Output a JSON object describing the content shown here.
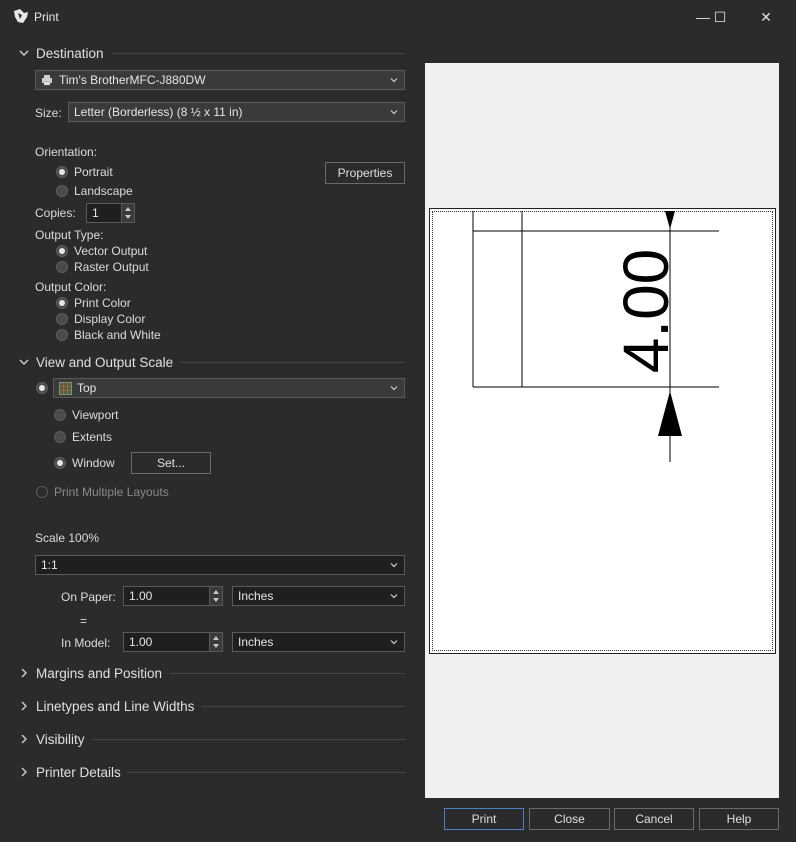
{
  "window": {
    "title": "Print",
    "minimize_glyph": "—",
    "maximize_glyph": "☐",
    "close_glyph": "✕"
  },
  "destination": {
    "header": "Destination",
    "printer": "Tim's BrotherMFC-J880DW",
    "size_label": "Size:",
    "size_value": "Letter (Borderless) (8 ½ x 11 in)",
    "orientation_label": "Orientation:",
    "portrait_label": "Portrait",
    "landscape_label": "Landscape",
    "orientation_selected": "Portrait",
    "properties_button": "Properties",
    "copies_label": "Copies:",
    "copies_value": "1",
    "output_type_label": "Output Type:",
    "vector_output_label": "Vector Output",
    "raster_output_label": "Raster Output",
    "output_type_selected": "Vector Output",
    "output_color_label": "Output Color:",
    "print_color_label": "Print Color",
    "display_color_label": "Display Color",
    "black_white_label": "Black and White",
    "output_color_selected": "Print Color"
  },
  "view_scale": {
    "header": "View and Output Scale",
    "view_value": "Top",
    "viewport_label": "Viewport",
    "extents_label": "Extents",
    "window_label": "Window",
    "area_selected": "Window",
    "set_button": "Set...",
    "print_multiple_label": "Print Multiple Layouts",
    "scale_label": "Scale 100%",
    "scale_value": "1:1",
    "on_paper_label": "On Paper:",
    "on_paper_value": "1.00",
    "on_paper_units": "Inches",
    "equals": "=",
    "in_model_label": "In Model:",
    "in_model_value": "1.00",
    "in_model_units": "Inches"
  },
  "collapsed_sections": {
    "margins": "Margins and Position",
    "linetypes": "Linetypes and Line Widths",
    "visibility": "Visibility",
    "printer_details": "Printer Details"
  },
  "preview": {
    "dimension_text": "4.00"
  },
  "footer": {
    "print_button": "Print",
    "close_button": "Close",
    "cancel_button": "Cancel",
    "help_button": "Help"
  },
  "colors": {
    "background": "#2b2b2b",
    "field": "#1f1f1f",
    "accent_border": "#4a7fc8",
    "preview_bg": "#f0f0f0"
  },
  "icons": [
    "rhino-app-icon",
    "printer-icon",
    "grid-view-icon",
    "chevron-down-icon",
    "chevron-right-icon"
  ]
}
